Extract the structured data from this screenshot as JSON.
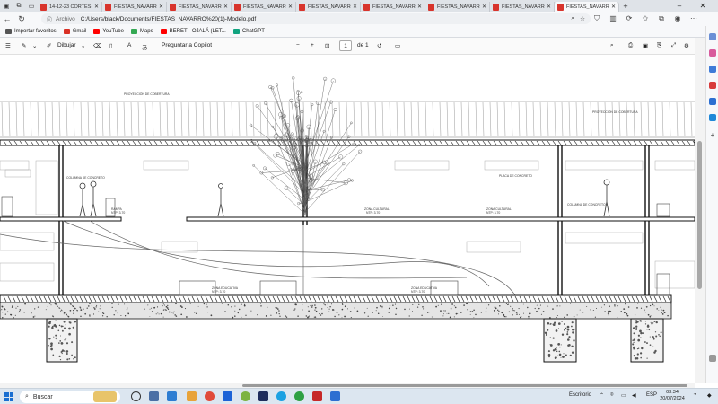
{
  "browser": {
    "tabs": [
      {
        "label": "14-12-23 CORTES"
      },
      {
        "label": "FIESTAS_NAVARRO"
      },
      {
        "label": "FIESTAS_NAVARRO"
      },
      {
        "label": "FIESTAS_NAVARRO"
      },
      {
        "label": "FIESTAS_NAVARRO"
      },
      {
        "label": "FIESTAS_NAVARRO"
      },
      {
        "label": "FIESTAS_NAVARRO"
      },
      {
        "label": "FIESTAS_NAVARRO"
      },
      {
        "label": "FIESTAS_NAVARRO"
      }
    ],
    "address": {
      "label": "Archivo",
      "url": "C:/Users/black/Documents/FIESTAS_NAVARRO%20(1)-Modelo.pdf"
    },
    "favorites": [
      {
        "label": "Importar favoritos",
        "color": "#555555"
      },
      {
        "label": "Gmail",
        "color": "#d93025"
      },
      {
        "label": "YouTube",
        "color": "#ff0000"
      },
      {
        "label": "Maps",
        "color": "#34a853"
      },
      {
        "label": "BERET - OJALÁ (LET...",
        "color": "#ff0000"
      },
      {
        "label": "ChatGPT",
        "color": "#10a37f"
      }
    ]
  },
  "pdf_toolbar": {
    "draw_label": "Dibujar",
    "copilot_label": "Preguntar a Copilot",
    "page_current": "1",
    "page_total": "de 1"
  },
  "drawing": {
    "labels": [
      "ZONA EDUCATIVA",
      "NTP: 3.70",
      "ZONA EDUCATIVA",
      "NTP: 3.70",
      "ZONA CULTURAL",
      "NTP: 3.70",
      "ZONA CULTURAL",
      "NTP: 3.70",
      "RAMPA",
      "NTP: 3.70",
      "COLUMNA DE CONCRETO",
      "PLACA DE CONCRETO",
      "PROYECCIÓN DE COBERTURA"
    ]
  },
  "taskbar": {
    "search_placeholder": "Buscar",
    "status": "Escritorio",
    "lang": "ESP",
    "time": "03:34",
    "date": "20/07/2024"
  }
}
